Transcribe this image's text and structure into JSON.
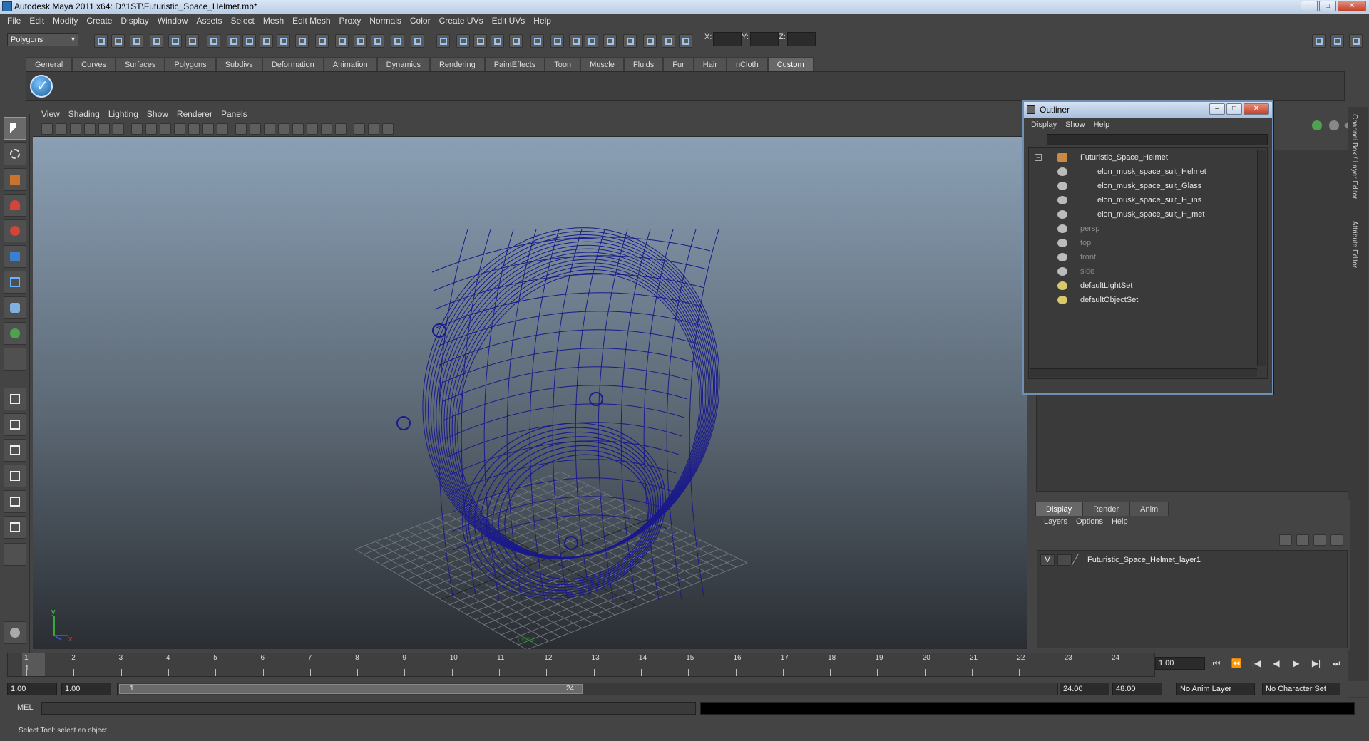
{
  "window": {
    "title": "Autodesk Maya 2011 x64: D:\\1ST\\Futuristic_Space_Helmet.mb*",
    "min": "–",
    "max": "□",
    "close": "✕"
  },
  "menubar": [
    "File",
    "Edit",
    "Modify",
    "Create",
    "Display",
    "Window",
    "Assets",
    "Select",
    "Mesh",
    "Edit Mesh",
    "Proxy",
    "Normals",
    "Color",
    "Create UVs",
    "Edit UVs",
    "Help"
  ],
  "toolbar": {
    "mode": "Polygons",
    "x_label": "X:",
    "y_label": "Y:",
    "z_label": "Z:"
  },
  "shelf_tabs": [
    "General",
    "Curves",
    "Surfaces",
    "Polygons",
    "Subdivs",
    "Deformation",
    "Animation",
    "Dynamics",
    "Rendering",
    "PaintEffects",
    "Toon",
    "Muscle",
    "Fluids",
    "Fur",
    "Hair",
    "nCloth",
    "Custom"
  ],
  "shelf_active": "Custom",
  "panel_menu": [
    "View",
    "Shading",
    "Lighting",
    "Show",
    "Renderer",
    "Panels"
  ],
  "viewport": {
    "axis_y": "y",
    "axis_x": "x",
    "camera_label": "persp"
  },
  "outliner": {
    "title": "Outliner",
    "menu": [
      "Display",
      "Show",
      "Help"
    ],
    "items": [
      {
        "label": "Futuristic_Space_Helmet",
        "dim": false,
        "level": 0,
        "icon": "transform-icon"
      },
      {
        "label": "elon_musk_space_suit_Helmet",
        "dim": false,
        "level": 1,
        "icon": "mesh-icon"
      },
      {
        "label": "elon_musk_space_suit_Glass",
        "dim": false,
        "level": 1,
        "icon": "mesh-icon"
      },
      {
        "label": "elon_musk_space_suit_H_ins",
        "dim": false,
        "level": 1,
        "icon": "mesh-icon"
      },
      {
        "label": "elon_musk_space_suit_H_met",
        "dim": false,
        "level": 1,
        "icon": "mesh-icon"
      },
      {
        "label": "persp",
        "dim": true,
        "level": 0,
        "icon": "camera-icon"
      },
      {
        "label": "top",
        "dim": true,
        "level": 0,
        "icon": "camera-icon"
      },
      {
        "label": "front",
        "dim": true,
        "level": 0,
        "icon": "camera-icon"
      },
      {
        "label": "side",
        "dim": true,
        "level": 0,
        "icon": "camera-icon"
      },
      {
        "label": "defaultLightSet",
        "dim": false,
        "level": 0,
        "icon": "set-icon"
      },
      {
        "label": "defaultObjectSet",
        "dim": false,
        "level": 0,
        "icon": "set-icon"
      }
    ]
  },
  "side_tabs": [
    "Channel Box / Layer Editor",
    "Attribute Editor"
  ],
  "layer_editor": {
    "tabs": [
      "Display",
      "Render",
      "Anim"
    ],
    "active_tab": "Display",
    "menu": [
      "Layers",
      "Options",
      "Help"
    ],
    "layers": [
      {
        "visible": "V",
        "name": "Futuristic_Space_Helmet_layer1"
      }
    ]
  },
  "timeline": {
    "ticks": [
      "1",
      "2",
      "3",
      "4",
      "5",
      "6",
      "7",
      "8",
      "9",
      "10",
      "11",
      "12",
      "13",
      "14",
      "15",
      "16",
      "17",
      "18",
      "19",
      "20",
      "21",
      "22",
      "23",
      "24"
    ],
    "current_frame_label": "1",
    "current_frame": "1.00",
    "play_buttons": [
      "⏮",
      "⏪",
      "|◀",
      "◀",
      "▶",
      "▶|",
      "⏭"
    ]
  },
  "range": {
    "start": "1.00",
    "playback_start": "1.00",
    "slider_start": "1",
    "slider_end": "24",
    "playback_end": "24.00",
    "end": "48.00",
    "anim_layer": "No Anim Layer",
    "character_set": "No Character Set"
  },
  "mel": {
    "label": "MEL"
  },
  "help_line": "Select Tool: select an object",
  "colors": {
    "wireframe": "#1a1a8c",
    "accent": "#6f8fb3"
  }
}
